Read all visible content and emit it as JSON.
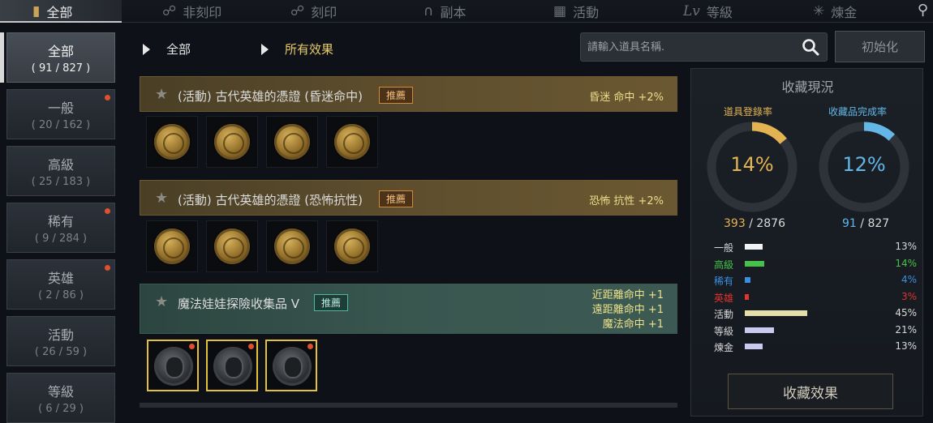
{
  "top_tabs": [
    {
      "label": "全部",
      "icon": "book-icon"
    },
    {
      "label": "非刻印",
      "icon": "shield-icon"
    },
    {
      "label": "刻印",
      "icon": "shield-lock-icon"
    },
    {
      "label": "副本",
      "icon": "magnet-icon"
    },
    {
      "label": "活動",
      "icon": "gift-icon"
    },
    {
      "label": "等級",
      "icon": "level-icon"
    },
    {
      "label": "煉金",
      "icon": "star-icon"
    }
  ],
  "sidebar": [
    {
      "label": "全部",
      "count": "( 91 / 827 )"
    },
    {
      "label": "一般",
      "count": "( 20 / 162 )"
    },
    {
      "label": "高級",
      "count": "( 25 / 183 )"
    },
    {
      "label": "稀有",
      "count": "( 9 / 284 )"
    },
    {
      "label": "英雄",
      "count": "( 2 / 86 )"
    },
    {
      "label": "活動",
      "count": "( 26 / 59 )"
    },
    {
      "label": "等級",
      "count": "( 6 / 29 )"
    }
  ],
  "filters": {
    "category": "全部",
    "effect": "所有效果"
  },
  "search": {
    "placeholder": "請輸入道具名稱.",
    "reset_label": "初始化"
  },
  "collections": [
    {
      "title": "(活動) 古代英雄的憑證 (昏迷命中)",
      "badge": "推薦",
      "effects": [
        "昏迷 命中 +2%"
      ]
    },
    {
      "title": "(活動) 古代英雄的憑證 (恐怖抗性)",
      "badge": "推薦",
      "effects": [
        "恐怖 抗性 +2%"
      ]
    },
    {
      "title": "魔法娃娃探險收集品 V",
      "badge": "推薦",
      "effects": [
        "近距離命中 +1",
        "遠距離命中 +1",
        "魔法命中 +1"
      ]
    }
  ],
  "panel": {
    "title": "收藏現況",
    "gauges": [
      {
        "label": "道具登錄率",
        "value": "14%",
        "fraction": 0.14,
        "current": "393",
        "total": "2876",
        "color": "#e3b352"
      },
      {
        "label": "收藏品完成率",
        "value": "12%",
        "fraction": 0.12,
        "current": "91",
        "total": "827",
        "color": "#63b6e6"
      }
    ],
    "separator": "/",
    "stats": [
      {
        "name": "一般",
        "pct": "13%",
        "fraction": 0.13,
        "color": "#f2f2f2",
        "text_color": "#d8d8d8"
      },
      {
        "name": "高級",
        "pct": "14%",
        "fraction": 0.14,
        "color": "#46c24a",
        "text_color": "#46c24a"
      },
      {
        "name": "稀有",
        "pct": "4%",
        "fraction": 0.04,
        "color": "#3c8fe0",
        "text_color": "#3c8fe0"
      },
      {
        "name": "英雄",
        "pct": "3%",
        "fraction": 0.03,
        "color": "#e0342f",
        "text_color": "#e0342f"
      },
      {
        "name": "活動",
        "pct": "45%",
        "fraction": 0.45,
        "color": "#e6deaa",
        "text_color": "#d8d8d8"
      },
      {
        "name": "等級",
        "pct": "21%",
        "fraction": 0.21,
        "color": "#c8caf0",
        "text_color": "#d8d8d8"
      },
      {
        "name": "煉金",
        "pct": "13%",
        "fraction": 0.13,
        "color": "#c8caf0",
        "text_color": "#d8d8d8"
      }
    ],
    "button_label": "收藏效果"
  }
}
